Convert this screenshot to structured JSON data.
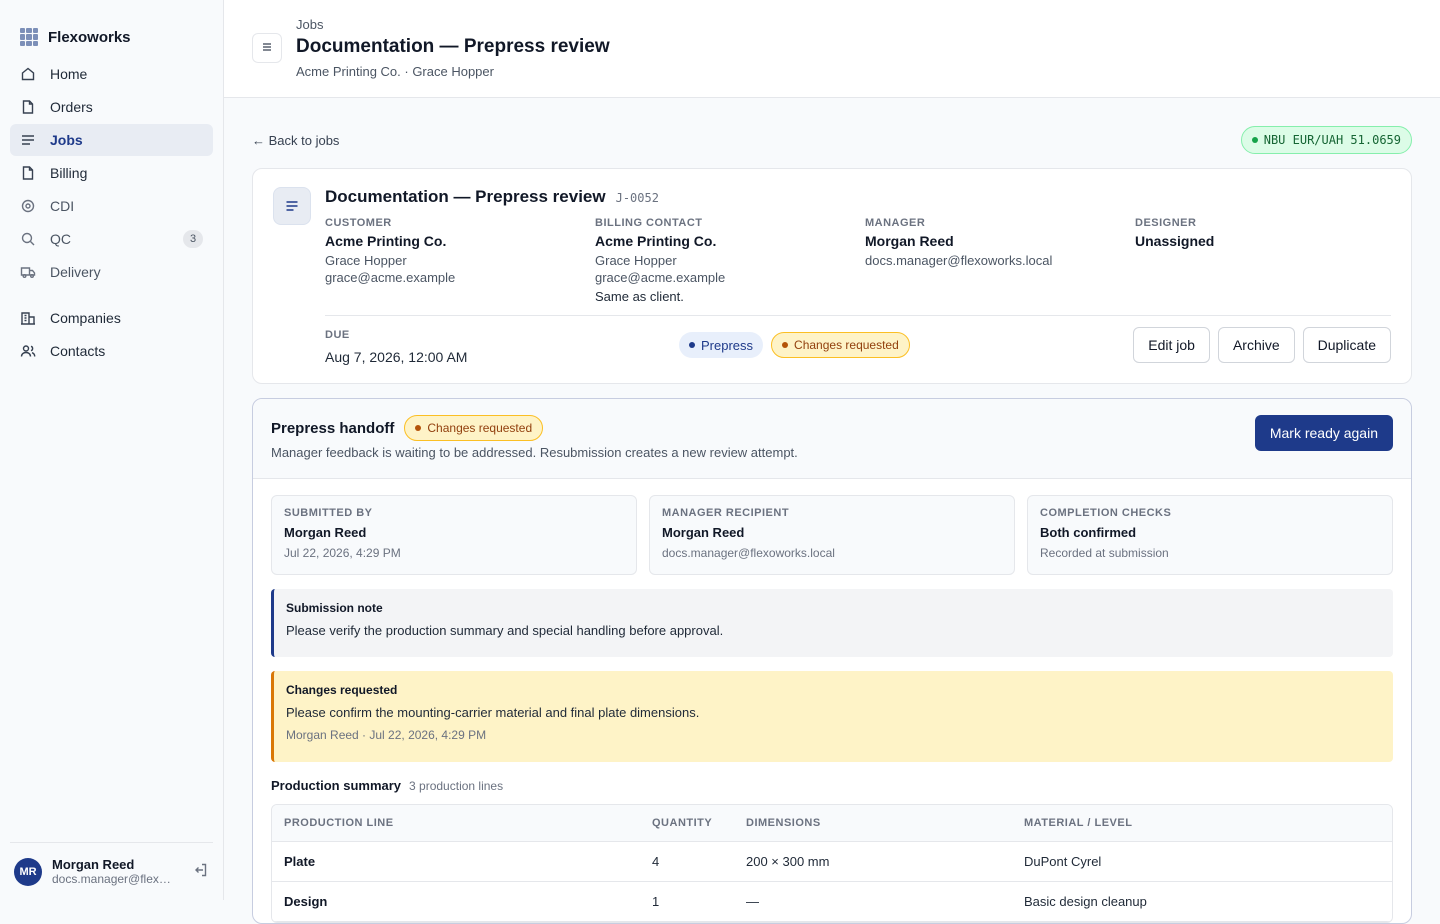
{
  "app": {
    "name": "Flexoworks"
  },
  "sidebar": {
    "items": [
      {
        "label": "Home",
        "icon": "home-icon"
      },
      {
        "label": "Orders",
        "icon": "file-icon"
      },
      {
        "label": "Jobs",
        "icon": "list-icon",
        "active": true
      },
      {
        "label": "Billing",
        "icon": "file-icon"
      },
      {
        "label": "CDI",
        "icon": "target-icon"
      },
      {
        "label": "QC",
        "icon": "search-icon",
        "badge": "3"
      },
      {
        "label": "Delivery",
        "icon": "truck-icon"
      }
    ],
    "secondary": [
      {
        "label": "Companies",
        "icon": "building-icon"
      },
      {
        "label": "Contacts",
        "icon": "users-icon"
      }
    ],
    "user": {
      "initials": "MR",
      "name": "Morgan Reed",
      "email": "docs.manager@flexoworks.local"
    }
  },
  "header": {
    "breadcrumb": "Jobs",
    "title": "Documentation — Prepress review",
    "subtitle": "Acme Printing Co. · Grace Hopper"
  },
  "topbar": {
    "back_label": "← Back to jobs",
    "rate_label": "NBU EUR/UAH 51.0659"
  },
  "job": {
    "title": "Documentation — Prepress review",
    "code": "J-0052",
    "customer": {
      "label": "Customer",
      "name": "Acme Printing Co.",
      "contact": "Grace Hopper",
      "email": "grace@acme.example"
    },
    "billing": {
      "label": "Billing contact",
      "name": "Acme Printing Co.",
      "contact": "Grace Hopper",
      "email": "grace@acme.example",
      "note": "Same as client."
    },
    "manager": {
      "label": "Manager",
      "name": "Morgan Reed",
      "email": "docs.manager@flexoworks.local"
    },
    "designer": {
      "label": "Designer",
      "name": "Unassigned"
    },
    "due": {
      "label": "Due",
      "value": "Aug 7, 2026, 12:00 AM"
    },
    "stage_chip": "Prepress",
    "status_chip": "Changes requested",
    "actions": {
      "edit": "Edit job",
      "archive": "Archive",
      "duplicate": "Duplicate"
    }
  },
  "handoff": {
    "title": "Prepress handoff",
    "status": "Changes requested",
    "description": "Manager feedback is waiting to be addressed. Resubmission creates a new review attempt.",
    "primary_action": "Mark ready again",
    "submitted_by": {
      "label": "Submitted by",
      "name": "Morgan Reed",
      "sub": "Jul 22, 2026, 4:29 PM"
    },
    "recipient": {
      "label": "Manager recipient",
      "name": "Morgan Reed",
      "sub": "docs.manager@flexoworks.local"
    },
    "checks": {
      "label": "Completion checks",
      "name": "Both confirmed",
      "sub": "Recorded at submission"
    },
    "note": {
      "title": "Submission note",
      "body": "Please verify the production summary and special handling before approval."
    },
    "changes": {
      "title": "Changes requested",
      "body": "Please confirm the mounting-carrier material and final plate dimensions.",
      "meta": "Morgan Reed · Jul 22, 2026, 4:29 PM"
    }
  },
  "production": {
    "title": "Production summary",
    "count": "3 production lines",
    "columns": [
      "Production line",
      "Quantity",
      "Dimensions",
      "Material / level"
    ],
    "rows": [
      {
        "line": "Plate",
        "qty": "4",
        "dims": "200 × 300 mm",
        "material": "DuPont Cyrel"
      },
      {
        "line": "Design",
        "qty": "1",
        "dims": "—",
        "material": "Basic design cleanup"
      }
    ]
  },
  "colors": {
    "accent": "#1e3a8a",
    "warning_bg": "#fef3c7",
    "warning_border": "#d97706",
    "success_bg": "#dcfce7"
  }
}
